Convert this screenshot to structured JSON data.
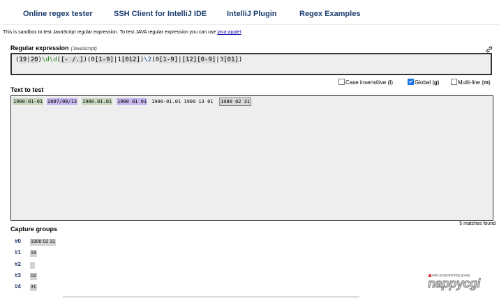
{
  "nav": {
    "links": [
      "Online regex tester",
      "SSH Client for IntelliJ IDE",
      "IntelliJ Plugin",
      "Regex Examples"
    ]
  },
  "intro": {
    "text": "This is sandbox to test JavaScript regular expression. To test JAVA regular expression you can use ",
    "link": "java-applet"
  },
  "regex": {
    "title": "Regular expression",
    "subtitle": "(JavaScript)",
    "pattern": "(19|20)\\d\\d([- /.])(0[1-9]|1[012])\\2(0[1-9]|[12][0-9]|3[01])",
    "tokens": {
      "t1": "(",
      "t2": "19",
      "t3": "|",
      "t4": "20",
      "t5": ")",
      "t6": "\\d\\d",
      "t7": "(",
      "t8": "[- /.]",
      "t9": ")(",
      "t10": "0",
      "t11": "[1-9]",
      "t12": "|",
      "t13": "1",
      "t14": "[012]",
      "t15": ")",
      "t16": "\\2",
      "t17": "(",
      "t18": "0",
      "t19": "[1-9]",
      "t20": "|",
      "t21": "[12]",
      "t22": "[0-9]",
      "t23": "|",
      "t24": "3",
      "t25": "[01]",
      "t26": ")"
    }
  },
  "options": {
    "case_insensitive": {
      "label": "Case insensitive (",
      "flag": "i",
      "close": ")",
      "checked": false
    },
    "global": {
      "label": "Global (",
      "flag": "g",
      "close": ")",
      "checked": true
    },
    "multiline": {
      "label": "Multi-line (",
      "flag": "m",
      "close": ")",
      "checked": false
    }
  },
  "test": {
    "title": "Text to test",
    "segments": [
      "1900-01-01",
      "2007/08/13",
      "1900.01.01",
      "1900 01 01",
      "1900-01.01 1900 13 01",
      "1900 02 31"
    ],
    "match_count": "5 matches found"
  },
  "capture": {
    "title": "Capture groups",
    "groups": [
      {
        "label": "#0",
        "value": "1900 02 31"
      },
      {
        "label": "#1",
        "value": "19"
      },
      {
        "label": "#2",
        "value": " "
      },
      {
        "label": "#3",
        "value": "02"
      },
      {
        "label": "#4",
        "value": "31"
      }
    ]
  },
  "logo": {
    "small": "web programming group",
    "big": "nappycgi"
  },
  "colors": {
    "nav_link": "#1a3c6e",
    "match_green": "#c8d8c0",
    "match_purple": "#c8b8ef",
    "group_label": "#1a2e5e",
    "checkbox_checked": "#1a73e8"
  }
}
